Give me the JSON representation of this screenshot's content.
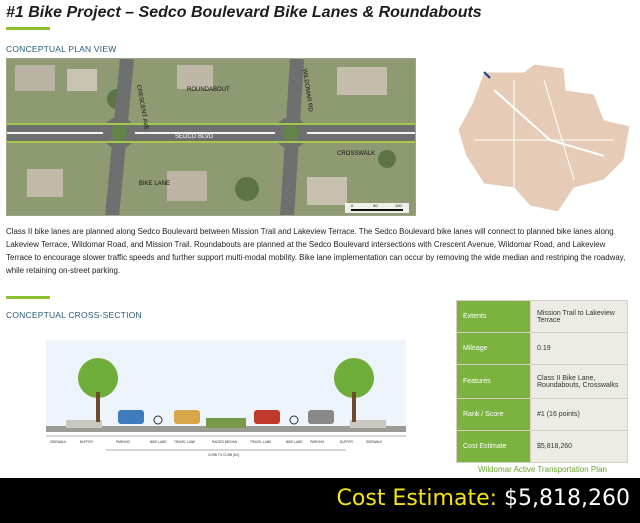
{
  "title": "#1 Bike Project – Sedco Boulevard Bike Lanes & Roundabouts",
  "plan_view": {
    "heading": "CONCEPTUAL PLAN VIEW",
    "labels": {
      "crescent": "CRESCENT AVE",
      "roundabout": "ROUNDABOUT",
      "wildomar": "WILDOMAR RD",
      "sedco": "SEDCO BLVD",
      "crosswalk": "CROSSWALK",
      "bike_lane": "BIKE LANE",
      "scale_0": "0",
      "scale_50": "50",
      "scale_100": "100"
    }
  },
  "description": "Class II bike lanes are planned along Sedco Boulevard between Mission Trail and Lakeview Terrace. The Sedco Boulevard bike lanes will connect to planned bike lanes along Lakeview Terrace, Wildomar Road, and Mission Trail. Roundabouts are planned at the Sedco Boulevard intersections with Crescent Avenue, Wildomar Road, and Lakeview Terrace to encourage slower traffic speeds and further support multi-modal mobility. Bike lane implementation can occur by removing the wide median and restriping the roadway, while retaining on-street parking.",
  "cross_section": {
    "heading": "CONCEPTUAL CROSS-SECTION",
    "segments": [
      "SIDEWALK",
      "BUFFER",
      "PARKING",
      "BIKE LANE",
      "TRAVEL LANE",
      "RAISED MEDIAN",
      "TRAVEL LANE",
      "BIKE LANE",
      "PARKING",
      "BUFFER",
      "SIDEWALK"
    ],
    "curb_label": "CURB TO CURB (84')"
  },
  "table": [
    {
      "key": "Extents",
      "value": "Mission Trail to Lakeview Terrace"
    },
    {
      "key": "Mileage",
      "value": "0.19"
    },
    {
      "key": "Features",
      "value": "Class II Bike Lane, Roundabouts, Crosswalks"
    },
    {
      "key": "Rank / Score",
      "value": "#1 (16 points)"
    },
    {
      "key": "Cost Estimate",
      "value": "$5,818,260"
    }
  ],
  "credit": "Wildomar Active Transportation Plan",
  "banner": {
    "label": "Cost Estimate:",
    "value": "$5,818,260"
  },
  "colors": {
    "accent_green": "#8dbf2e",
    "table_green": "#7bb33e",
    "banner_yellow": "#f5e412"
  }
}
